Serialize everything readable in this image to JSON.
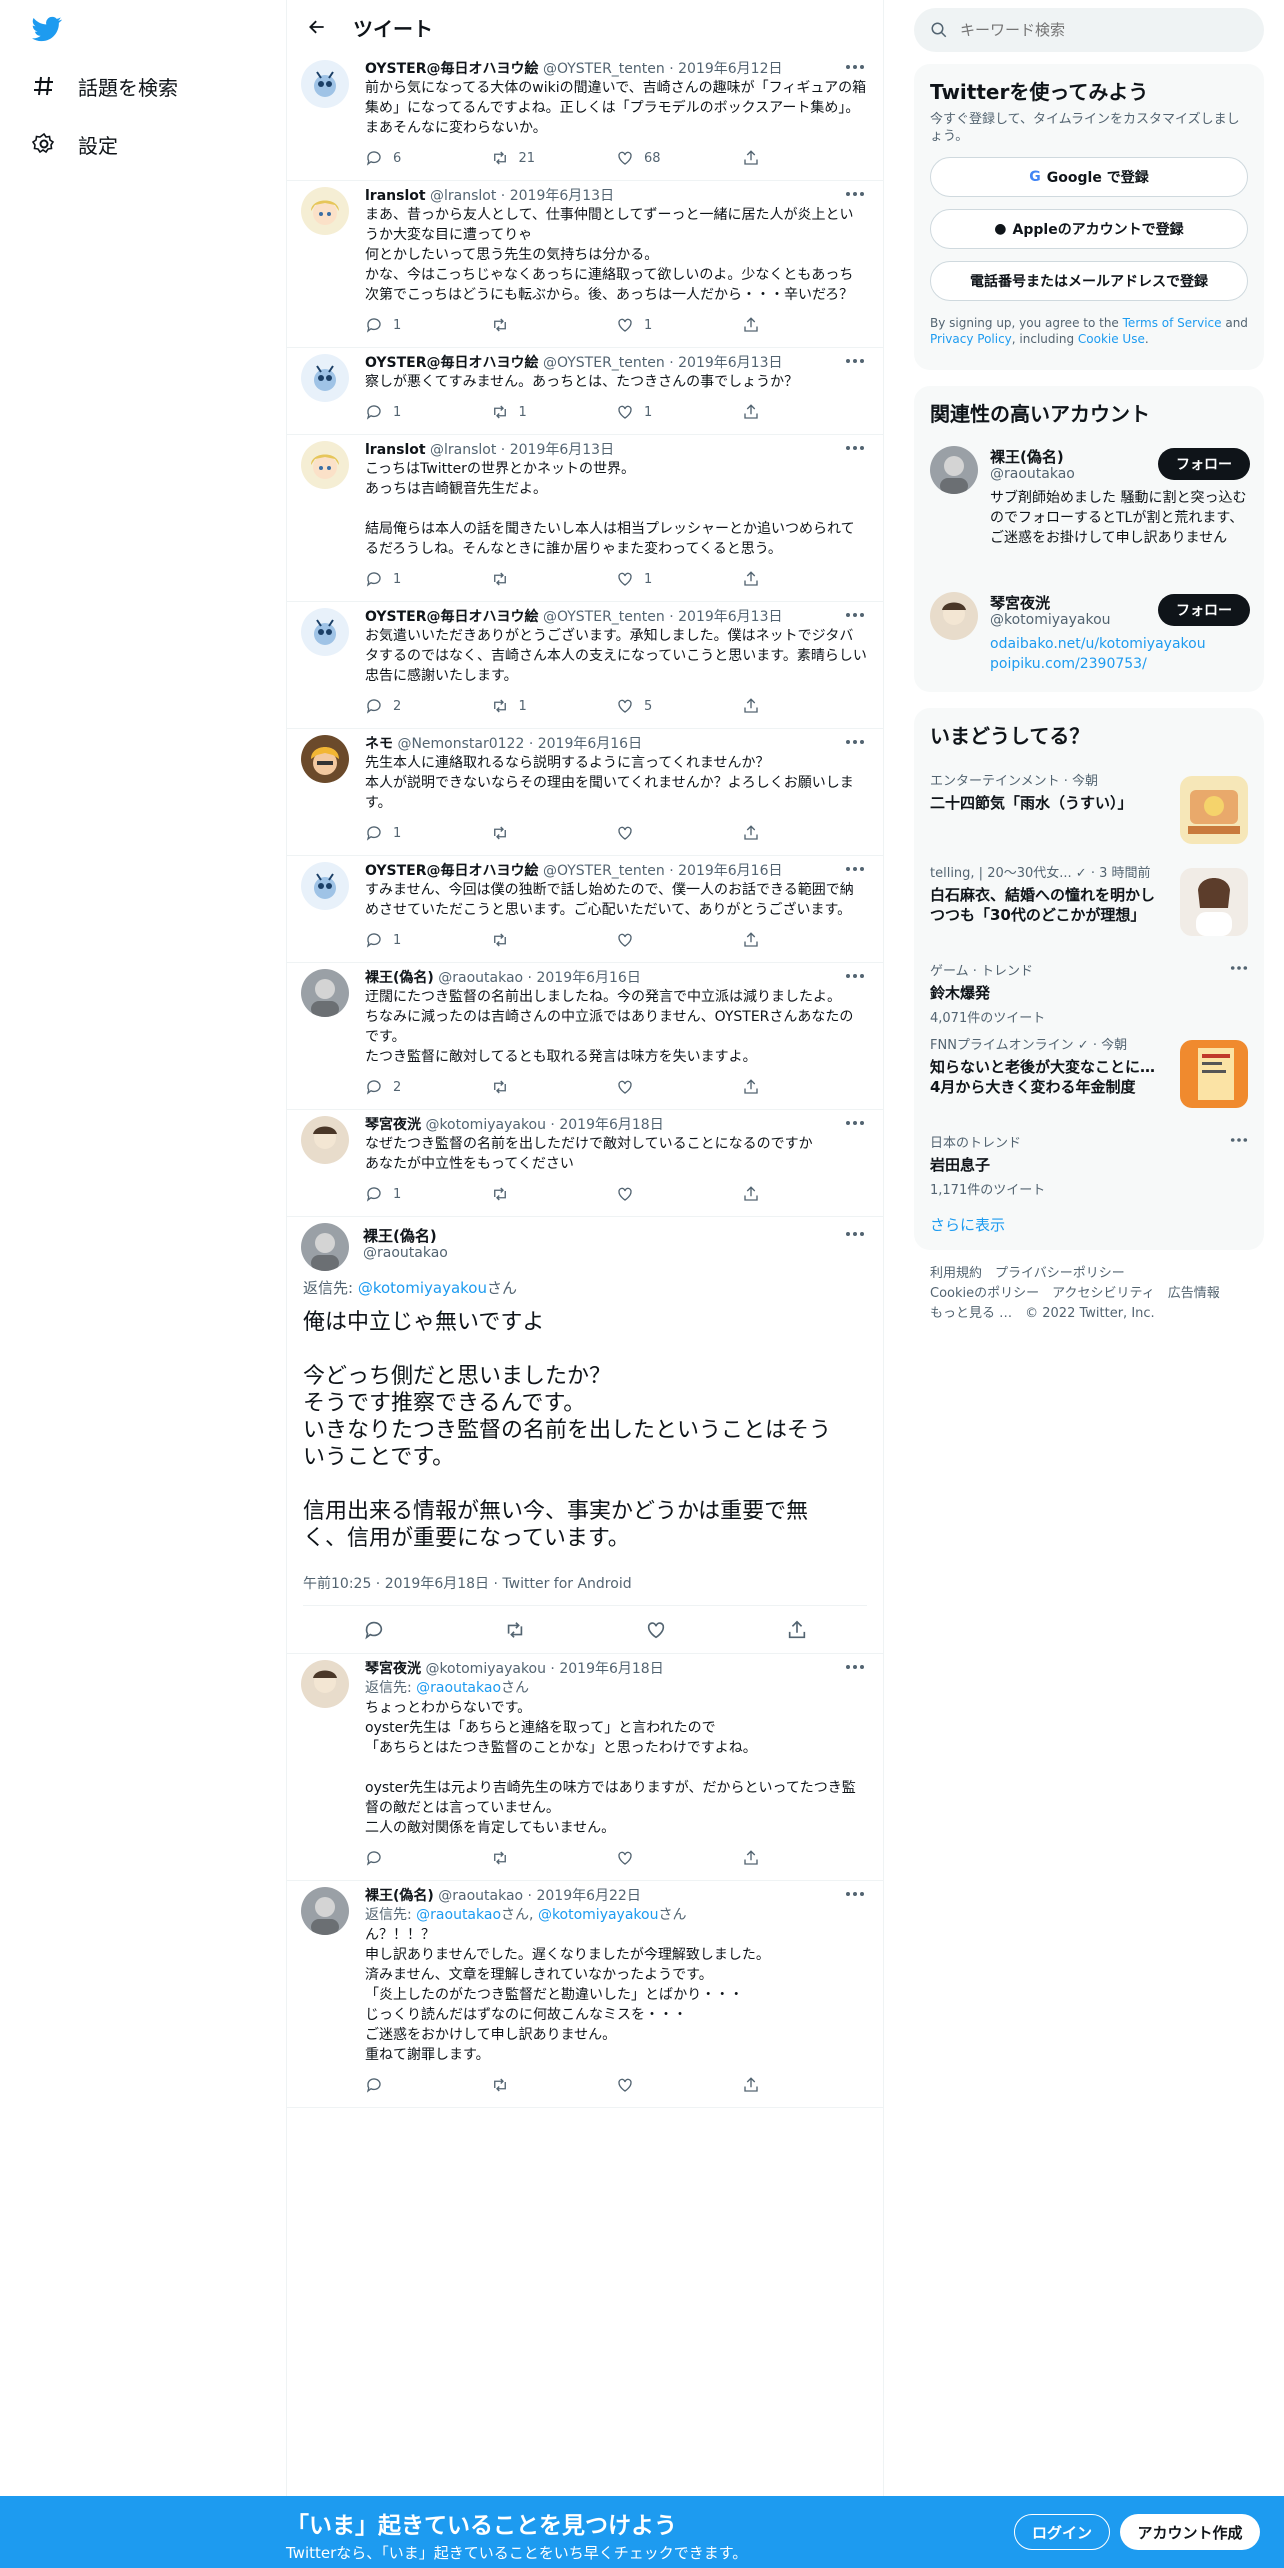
{
  "nav": {
    "explore_label": "話題を検索",
    "settings_label": "設定"
  },
  "header": {
    "title": "ツイート"
  },
  "tweets": [
    {
      "name": "OYSTER@毎日オハヨウ絵",
      "handle": "@OYSTER_tenten",
      "date": "2019年6月12日",
      "text": "前から気になってる大体のwikiの間違いで、吉崎さんの趣味が「フィギュアの箱集め」になってるんですよね。正しくは「プラモデルのボックスアート集め」。まあそんなに変わらないか。",
      "replies": "6",
      "retweets": "21",
      "likes": "68"
    },
    {
      "name": "lranslot",
      "handle": "@lranslot",
      "date": "2019年6月13日",
      "text": "まあ、昔っから友人として、仕事仲間としてずーっと一緒に居た人が炎上というか大変な目に遭ってりゃ\n何とかしたいって思う先生の気持ちは分かる。\nかな、今はこっちじゃなくあっちに連絡取って欲しいのよ。少なくともあっち次第でこっちはどうにも転ぶから。後、あっちは一人だから・・・辛いだろ？",
      "replies": "1",
      "retweets": "",
      "likes": "1"
    },
    {
      "name": "OYSTER@毎日オハヨウ絵",
      "handle": "@OYSTER_tenten",
      "date": "2019年6月13日",
      "text": "察しが悪くてすみません。あっちとは、たつきさんの事でしょうか？",
      "replies": "1",
      "retweets": "1",
      "likes": "1"
    },
    {
      "name": "lranslot",
      "handle": "@lranslot",
      "date": "2019年6月13日",
      "text": "こっちはTwitterの世界とかネットの世界。\nあっちは吉崎観音先生だよ。\n\n結局俺らは本人の話を聞きたいし本人は相当プレッシャーとか追いつめられてるだろうしね。そんなときに誰か居りゃまた変わってくると思う。",
      "replies": "1",
      "retweets": "",
      "likes": "1"
    },
    {
      "name": "OYSTER@毎日オハヨウ絵",
      "handle": "@OYSTER_tenten",
      "date": "2019年6月13日",
      "text": "お気遣いいただきありがとうございます。承知しました。僕はネットでジタバタするのではなく、吉崎さん本人の支えになっていこうと思います。素晴らしい忠告に感謝いたします。",
      "replies": "2",
      "retweets": "1",
      "likes": "5"
    },
    {
      "name": "ネモ",
      "handle": "@Nemonstar0122",
      "date": "2019年6月16日",
      "text": "先生本人に連絡取れるなら説明するように言ってくれませんか？\n本人が説明できないならその理由を聞いてくれませんか？よろしくお願いします。",
      "replies": "1",
      "retweets": "",
      "likes": ""
    },
    {
      "name": "OYSTER@毎日オハヨウ絵",
      "handle": "@OYSTER_tenten",
      "date": "2019年6月16日",
      "text": "すみません、今回は僕の独断で話し始めたので、僕一人のお話できる範囲で納めさせていただこうと思います。ご心配いただいて、ありがとうございます。",
      "replies": "1",
      "retweets": "",
      "likes": ""
    },
    {
      "name": "裸王(偽名)",
      "handle": "@raoutakao",
      "date": "2019年6月16日",
      "text": "迂闊にたつき監督の名前出しましたね。今の発言で中立派は減りましたよ。\nちなみに減ったのは吉崎さんの中立派ではありません、OYSTERさんあなたのです。\nたつき監督に敵対してるとも取れる発言は味方を失いますよ。",
      "replies": "2",
      "retweets": "",
      "likes": ""
    },
    {
      "name": "琴宮夜洸",
      "handle": "@kotomiyayakou",
      "date": "2019年6月18日",
      "text": "なぜたつき監督の名前を出しただけで敵対していることになるのですか\nあなたが中立性をもってください",
      "replies": "1",
      "retweets": "",
      "likes": ""
    }
  ],
  "focus": {
    "name": "裸王(偽名)",
    "handle": "@raoutakao",
    "reply_prefix": "返信先: ",
    "reply_to": "@kotomiyayakou",
    "reply_suffix": "さん",
    "text": "俺は中立じゃ無いですよ\n\n今どっち側だと思いましたか？\nそうです推察できるんです。\nいきなりたつき監督の名前を出したということはそういうことです。\n\n信用出来る情報が無い今、事実かどうかは重要で無く、信用が重要になっています。",
    "meta": "午前10:25 · 2019年6月18日 · Twitter for Android"
  },
  "replies_after": [
    {
      "name": "琴宮夜洸",
      "handle": "@kotomiyayakou",
      "date": "2019年6月18日",
      "reply_to": "@raoutakao",
      "reply_suffix": "さん",
      "text": "ちょっとわからないです。\noyster先生は「あちらと連絡を取って」と言われたので\n「あちらとはたつき監督のことかな」と思ったわけですよね。\n\noyster先生は元より吉崎先生の味方ではありますが、だからといってたつき監督の敵だとは言っていません。\n二人の敵対関係を肯定してもいません。"
    },
    {
      "name": "裸王(偽名)",
      "handle": "@raoutakao",
      "date": "2019年6月22日",
      "reply_to": "@raoutakao",
      "reply_to2": "@kotomiyayakou",
      "reply_suffix": "さん",
      "text": "ん？！！？\n申し訳ありませんでした。遅くなりましたが今理解致しました。\n済みません、文章を理解しきれていなかったようです。\n「炎上したのがたつき監督だと勘違いした」とばかり・・・\nじっくり読んだはずなのに何故こんなミスを・・・\nご迷惑をおかけして申し訳ありません。\n重ねて謝罪します。"
    }
  ],
  "search": {
    "placeholder": "キーワード検索"
  },
  "signup": {
    "title": "Twitterを使ってみよう",
    "subtitle": "今すぐ登録して、タイムラインをカスタマイズしましょう。",
    "google": "Google で登録",
    "apple": "Appleのアカウントで登録",
    "phone": "電話番号またはメールアドレスで登録",
    "legal_1": "By signing up, you agree to the ",
    "terms": "Terms of Service",
    "legal_2": " and ",
    "privacy": "Privacy Policy",
    "legal_3": ", including ",
    "cookie": "Cookie Use",
    "legal_4": "."
  },
  "related": {
    "title": "関連性の高いアカウント",
    "accounts": [
      {
        "name": "裸王(偽名)",
        "handle": "@raoutakao",
        "bio": "サブ剤師始めました 騒動に割と突っ込むのでフォローするとTLが割と荒れます、ご迷惑をお掛けして申し訳ありません",
        "follow": "フォロー"
      },
      {
        "name": "琴宮夜洸",
        "handle": "@kotomiyayakou",
        "bio": "odaibako.net/u/kotomiyayakou\npoipiku.com/2390753/",
        "follow": "フォロー"
      }
    ]
  },
  "trends": {
    "title": "いまどうしてる？",
    "items": [
      {
        "context": "エンターテインメント · 今朝",
        "title": "二十四節気「雨水（うすい）」"
      },
      {
        "context": "telling, | 20～30代女... ✓ · 3 時間前",
        "title": "白石麻衣、結婚への憧れを明かしつつも「30代のどこかが理想」"
      },
      {
        "context": "ゲーム · トレンド",
        "title": "鈴木爆発",
        "count": "4,071件のツイート"
      },
      {
        "context": "FNNプライムオンライン ✓ · 今朝",
        "title": "知らないと老後が大変なことに… 4月から大きく変わる年金制度"
      },
      {
        "context": "日本のトレンド",
        "title": "岩田息子",
        "count": "1,171件のツイート"
      }
    ],
    "show_more": "さらに表示"
  },
  "footer": {
    "line1": "利用規約　プライバシーポリシー",
    "line2": "Cookieのポリシー　アクセシビリティ　広告情報",
    "line3": "もっと見る …　© 2022 Twitter, Inc."
  },
  "bottom": {
    "title": "「いま」起きていることを見つけよう",
    "subtitle": "Twitterなら、「いま」起きていることをいち早くチェックできます。",
    "login": "ログイン",
    "signup": "アカウント作成"
  },
  "colors": {
    "accent": "#1d9bf0",
    "text": "#0f1419",
    "muted": "#536471",
    "border": "#eff3f4"
  }
}
